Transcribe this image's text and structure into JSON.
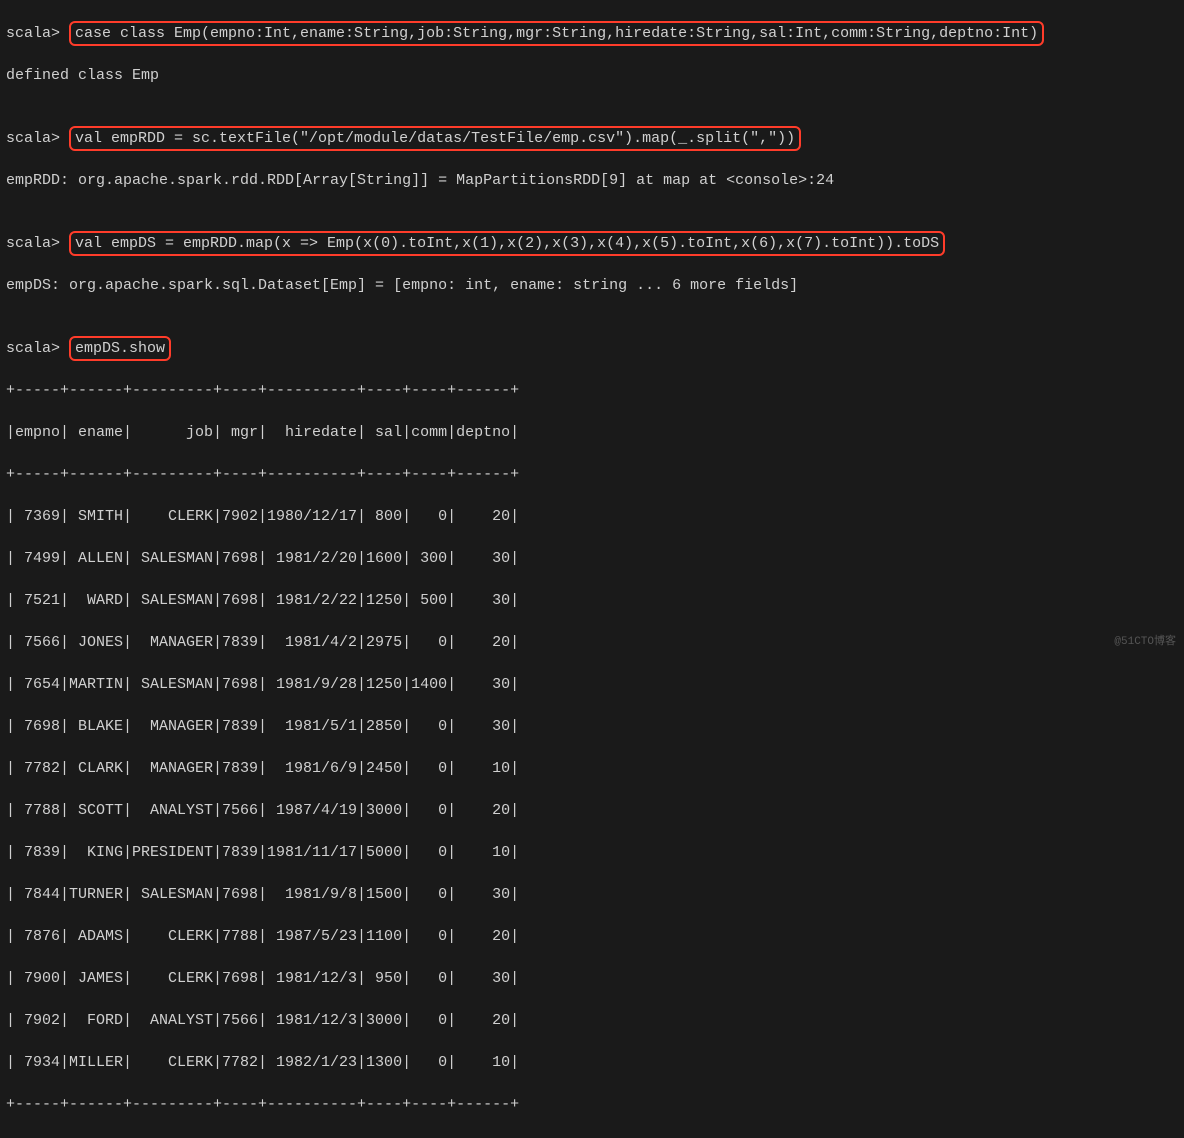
{
  "line1_prompt": "scala> ",
  "line1_cmd": "case class Emp(empno:Int,ename:String,job:String,mgr:String,hiredate:String,sal:Int,comm:String,deptno:Int)",
  "line2": "defined class Emp",
  "blank": "",
  "line3_prompt": "scala> ",
  "line3_cmd": "val empRDD = sc.textFile(\"/opt/module/datas/TestFile/emp.csv\").map(_.split(\",\"))",
  "line4": "empRDD: org.apache.spark.rdd.RDD[Array[String]] = MapPartitionsRDD[9] at map at <console>:24",
  "line5_prompt": "scala> ",
  "line5_cmd": "val empDS = empRDD.map(x => Emp(x(0).toInt,x(1),x(2),x(3),x(4),x(5).toInt,x(6),x(7).toInt)).toDS",
  "line6": "empDS: org.apache.spark.sql.Dataset[Emp] = [empno: int, ename: string ... 6 more fields]",
  "line7_prompt": "scala> ",
  "line7_cmd": "empDS.show",
  "sep": "+-----+------+---------+----+----------+----+----+------+",
  "header": "|empno| ename|      job| mgr|  hiredate| sal|comm|deptno|",
  "rows": [
    "| 7369| SMITH|    CLERK|7902|1980/12/17| 800|   0|    20|",
    "| 7499| ALLEN| SALESMAN|7698| 1981/2/20|1600| 300|    30|",
    "| 7521|  WARD| SALESMAN|7698| 1981/2/22|1250| 500|    30|",
    "| 7566| JONES|  MANAGER|7839|  1981/4/2|2975|   0|    20|",
    "| 7654|MARTIN| SALESMAN|7698| 1981/9/28|1250|1400|    30|",
    "| 7698| BLAKE|  MANAGER|7839|  1981/5/1|2850|   0|    30|",
    "| 7782| CLARK|  MANAGER|7839|  1981/6/9|2450|   0|    10|",
    "| 7788| SCOTT|  ANALYST|7566| 1987/4/19|3000|   0|    20|",
    "| 7839|  KING|PRESIDENT|7839|1981/11/17|5000|   0|    10|",
    "| 7844|TURNER| SALESMAN|7698|  1981/9/8|1500|   0|    30|",
    "| 7876| ADAMS|    CLERK|7788| 1987/5/23|1100|   0|    20|",
    "| 7900| JAMES|    CLERK|7698| 1981/12/3| 950|   0|    30|",
    "| 7902|  FORD|  ANALYST|7566| 1981/12/3|3000|   0|    20|",
    "| 7934|MILLER|    CLERK|7782| 1982/1/23|1300|   0|    10|"
  ],
  "watermark": "@51CTO博客",
  "chart_data": {
    "type": "table",
    "title": "empDS.show",
    "columns": [
      "empno",
      "ename",
      "job",
      "mgr",
      "hiredate",
      "sal",
      "comm",
      "deptno"
    ],
    "data": [
      {
        "empno": 7369,
        "ename": "SMITH",
        "job": "CLERK",
        "mgr": "7902",
        "hiredate": "1980/12/17",
        "sal": 800,
        "comm": "0",
        "deptno": 20
      },
      {
        "empno": 7499,
        "ename": "ALLEN",
        "job": "SALESMAN",
        "mgr": "7698",
        "hiredate": "1981/2/20",
        "sal": 1600,
        "comm": "300",
        "deptno": 30
      },
      {
        "empno": 7521,
        "ename": "WARD",
        "job": "SALESMAN",
        "mgr": "7698",
        "hiredate": "1981/2/22",
        "sal": 1250,
        "comm": "500",
        "deptno": 30
      },
      {
        "empno": 7566,
        "ename": "JONES",
        "job": "MANAGER",
        "mgr": "7839",
        "hiredate": "1981/4/2",
        "sal": 2975,
        "comm": "0",
        "deptno": 20
      },
      {
        "empno": 7654,
        "ename": "MARTIN",
        "job": "SALESMAN",
        "mgr": "7698",
        "hiredate": "1981/9/28",
        "sal": 1250,
        "comm": "1400",
        "deptno": 30
      },
      {
        "empno": 7698,
        "ename": "BLAKE",
        "job": "MANAGER",
        "mgr": "7839",
        "hiredate": "1981/5/1",
        "sal": 2850,
        "comm": "0",
        "deptno": 30
      },
      {
        "empno": 7782,
        "ename": "CLARK",
        "job": "MANAGER",
        "mgr": "7839",
        "hiredate": "1981/6/9",
        "sal": 2450,
        "comm": "0",
        "deptno": 10
      },
      {
        "empno": 7788,
        "ename": "SCOTT",
        "job": "ANALYST",
        "mgr": "7566",
        "hiredate": "1987/4/19",
        "sal": 3000,
        "comm": "0",
        "deptno": 20
      },
      {
        "empno": 7839,
        "ename": "KING",
        "job": "PRESIDENT",
        "mgr": "7839",
        "hiredate": "1981/11/17",
        "sal": 5000,
        "comm": "0",
        "deptno": 10
      },
      {
        "empno": 7844,
        "ename": "TURNER",
        "job": "SALESMAN",
        "mgr": "7698",
        "hiredate": "1981/9/8",
        "sal": 1500,
        "comm": "0",
        "deptno": 30
      },
      {
        "empno": 7876,
        "ename": "ADAMS",
        "job": "CLERK",
        "mgr": "7788",
        "hiredate": "1987/5/23",
        "sal": 1100,
        "comm": "0",
        "deptno": 20
      },
      {
        "empno": 7900,
        "ename": "JAMES",
        "job": "CLERK",
        "mgr": "7698",
        "hiredate": "1981/12/3",
        "sal": 950,
        "comm": "0",
        "deptno": 30
      },
      {
        "empno": 7902,
        "ename": "FORD",
        "job": "ANALYST",
        "mgr": "7566",
        "hiredate": "1981/12/3",
        "sal": 3000,
        "comm": "0",
        "deptno": 20
      },
      {
        "empno": 7934,
        "ename": "MILLER",
        "job": "CLERK",
        "mgr": "7782",
        "hiredate": "1982/1/23",
        "sal": 1300,
        "comm": "0",
        "deptno": 10
      }
    ]
  }
}
